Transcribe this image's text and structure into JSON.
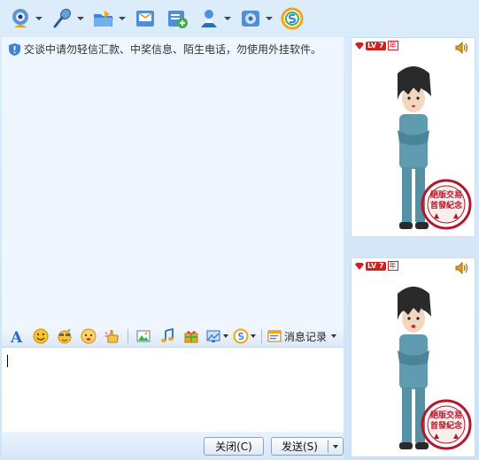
{
  "toolbar": {
    "buttons": [
      {
        "name": "video-call",
        "icon": "webcam-icon",
        "has_dropdown": true
      },
      {
        "name": "voice-call",
        "icon": "microphone-icon",
        "has_dropdown": true
      },
      {
        "name": "send-file",
        "icon": "folder-icon",
        "has_dropdown": true
      },
      {
        "name": "send-mail",
        "icon": "mail-icon",
        "has_dropdown": false
      },
      {
        "name": "create-discussion",
        "icon": "add-group-icon",
        "has_dropdown": false
      },
      {
        "name": "app",
        "icon": "people-icon",
        "has_dropdown": true
      },
      {
        "name": "settings",
        "icon": "gear-icon",
        "has_dropdown": true
      },
      {
        "name": "search",
        "icon": "soso-icon",
        "has_dropdown": false
      }
    ]
  },
  "chat": {
    "notice": "交谈中请勿轻信汇款、中奖信息、陌生电话，勿使用外挂软件。"
  },
  "format_bar": {
    "icons": [
      "font-icon",
      "smiley-icon",
      "magic-face-icon",
      "scrawl-icon",
      "shake-icon",
      "image-icon",
      "music-icon",
      "gift-icon"
    ],
    "history_label": "消息记录"
  },
  "buttons": {
    "close": "关闭(C)",
    "send": "发送(S)"
  },
  "shows": [
    {
      "level": "LV 7",
      "year": "年",
      "stamp_text": "絕版交易 首發紀念"
    },
    {
      "level": "LV 7",
      "year": "年",
      "stamp_text": "絕版交易 首發紀念"
    }
  ],
  "colors": {
    "accent": "#3a7bd5",
    "badge_red": "#d41f1f",
    "panel_bg": "#eef6ff"
  }
}
